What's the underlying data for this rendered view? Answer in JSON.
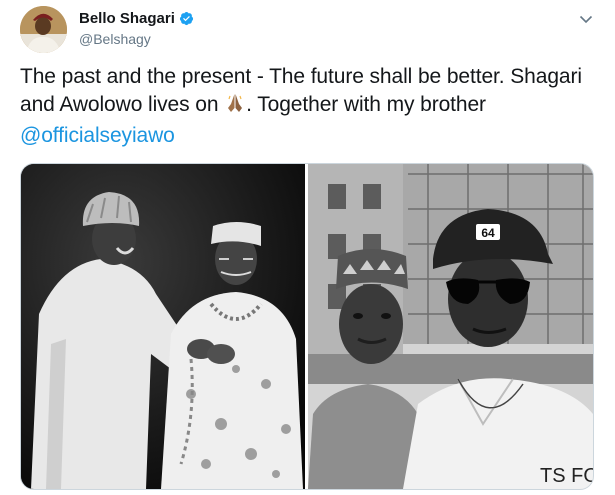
{
  "author": {
    "display_name": "Bello Shagari",
    "handle": "@Belshagy",
    "verified": true,
    "avatar_icon": "profile-photo"
  },
  "tweet": {
    "text_before": "The past and the present - The future shall be better. Shagari and Awolowo lives on ",
    "emoji": "folded-hands-emoji",
    "text_after": ". Together with my brother ",
    "mention": "@officialseyiawo"
  },
  "media": {
    "photos": [
      {
        "subject": "archival black-and-white photo of two elders shaking hands"
      },
      {
        "subject": "black-and-white selfie of two young men outdoors"
      }
    ],
    "cap_text": "64",
    "shirt_text": "TS FO"
  },
  "colors": {
    "link": "#1b95e0",
    "verified_badge": "#1da1f2",
    "secondary_text": "#657786",
    "border": "#ccd6dd"
  }
}
